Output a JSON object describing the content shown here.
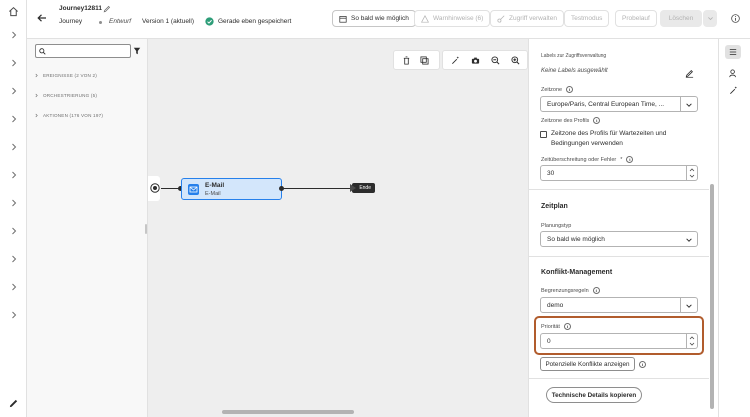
{
  "header": {
    "journey_name": "Journey12811",
    "journey_type": "Journey",
    "status": "Entwurf",
    "version": "Version 1 (aktuell)",
    "save_state": "Gerade eben gespeichert",
    "buttons": {
      "schedule": "So bald wie möglich",
      "warnings": "Warnhinweise (6)",
      "access": "Zugriff verwalten",
      "test": "Testmodus",
      "dry_run": "Probelauf",
      "delete": "Löschen"
    }
  },
  "left_panel": {
    "search_placeholder": "",
    "groups": [
      {
        "label": "EREIGNISSE (2 VON 2)"
      },
      {
        "label": "ORCHESTRIERUNG (5)"
      },
      {
        "label": "AKTIONEN (176 VON 197)"
      }
    ]
  },
  "canvas": {
    "node_title": "E-Mail",
    "node_subtitle": "E-Mail",
    "end_label": "Ende"
  },
  "right_panel": {
    "access_labels_heading": "Labels zur Zugriffsverwaltung",
    "access_labels_value": "Keine Labels ausgewählt",
    "timezone_label": "Zeitzone",
    "timezone_value": "Europe/Paris, Central European Time, ...",
    "profile_tz_label": "Zeitzone des Profils",
    "profile_tz_checkbox": "Zeitzone des Profils für Wartezeiten und Bedingungen verwenden",
    "timeout_label": "Zeitüberschreitung oder Fehler",
    "timeout_required": "*",
    "timeout_value": "30",
    "schedule_section": "Zeitplan",
    "schedule_type_label": "Planungstyp",
    "schedule_type_value": "So bald wie möglich",
    "conflict_section": "Konflikt-Management",
    "rules_label": "Begrenzungsregeln",
    "rules_value": "demo",
    "priority_label": "Priorität",
    "priority_value": "0",
    "conflicts_button": "Potenzielle Konflikte anzeigen",
    "tech_details_button": "Technische Details kopieren"
  },
  "colors": {
    "accent_blue": "#2680eb",
    "node_fill": "#d3e6fb",
    "highlight_border": "#b15c2d",
    "success_green": "#2d9d78"
  }
}
